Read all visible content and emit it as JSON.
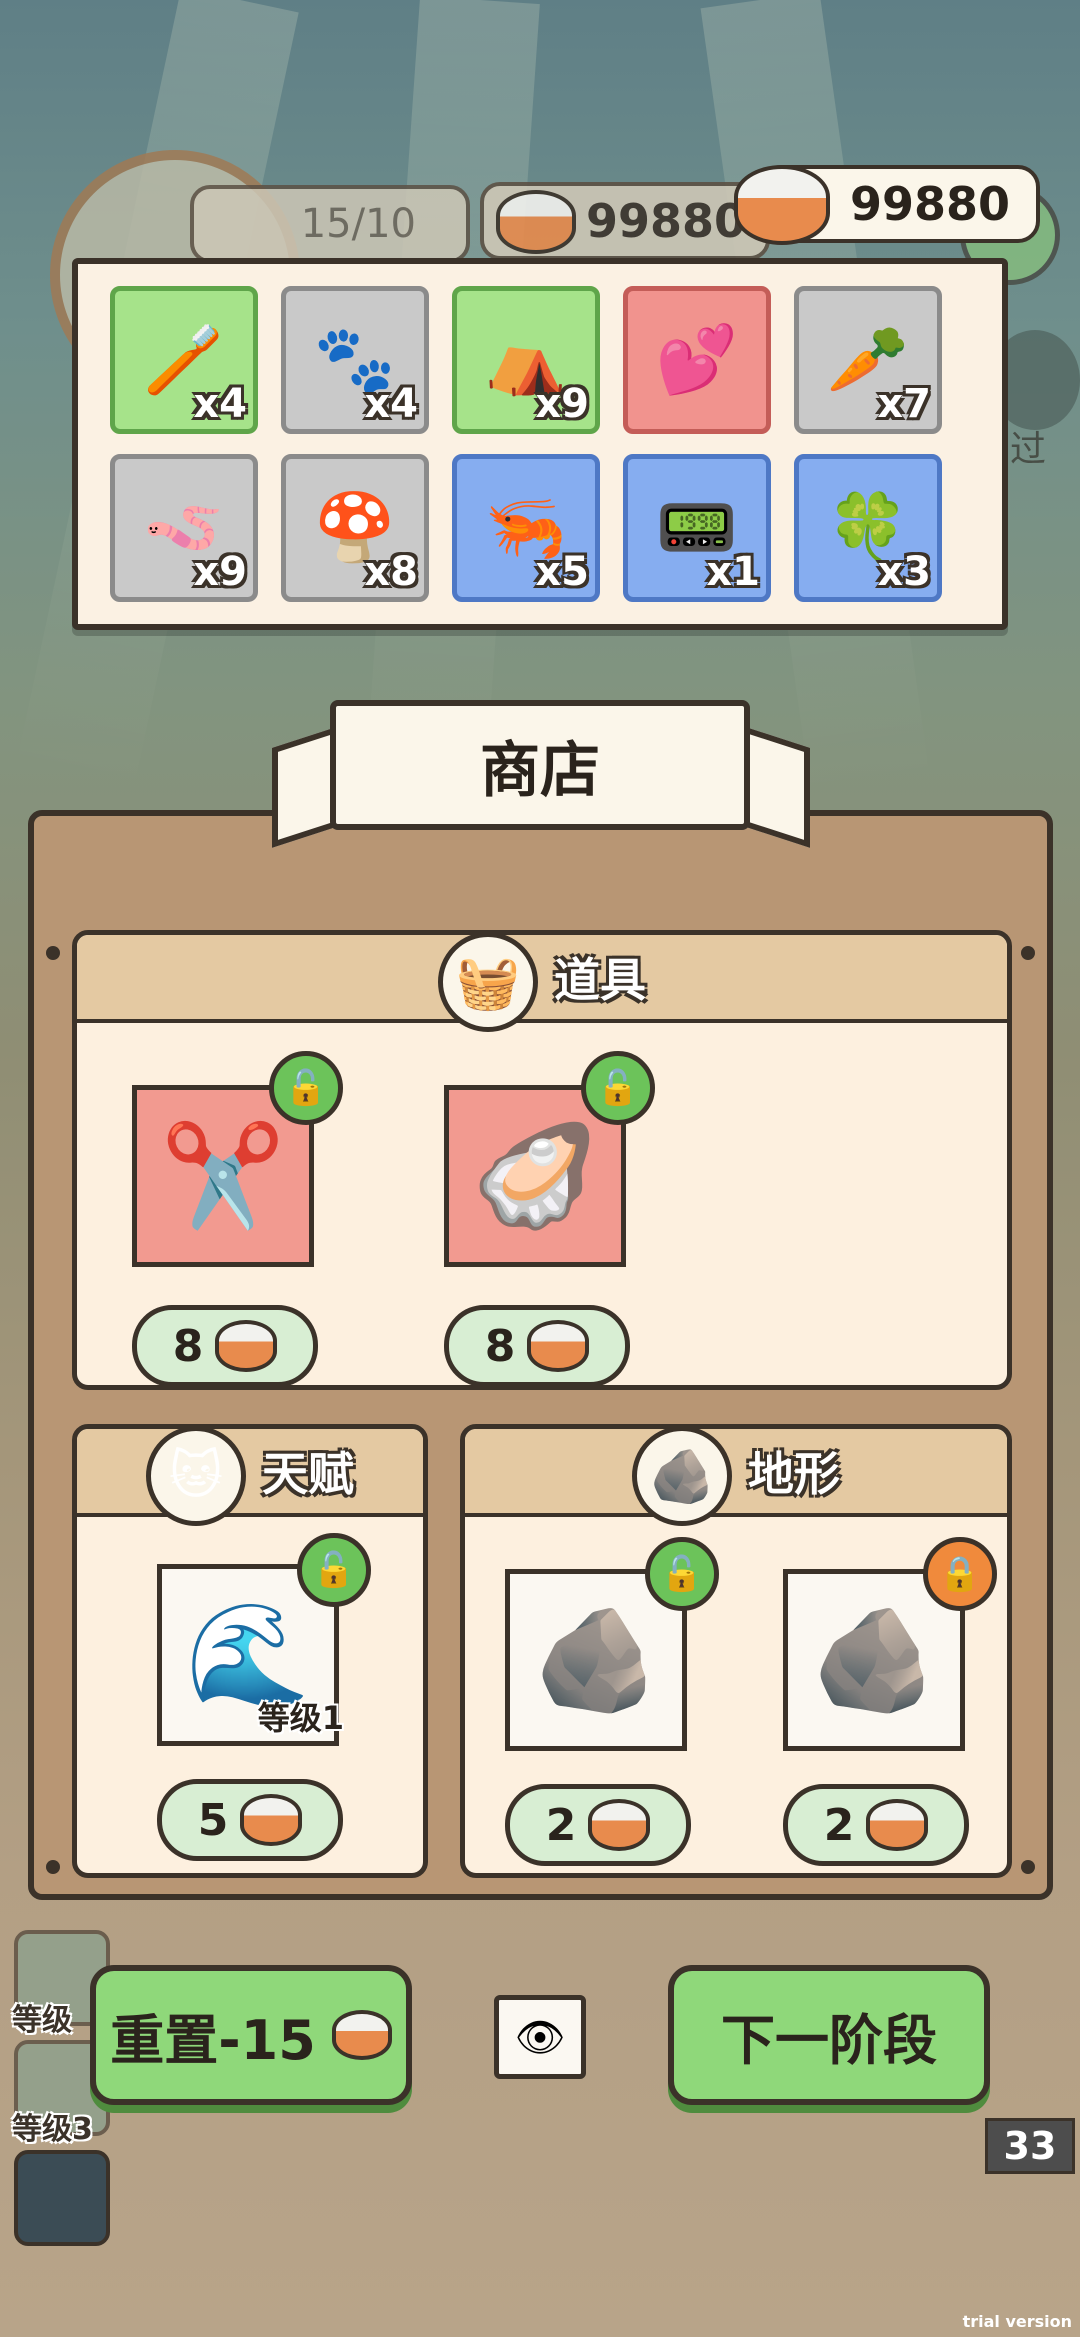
{
  "hud": {
    "level": "15/10",
    "coins_bg": "99880",
    "coins": "99880"
  },
  "inventory": [
    {
      "icon": "brush-icon",
      "glyph": "🪥",
      "count": "x4",
      "color": "green"
    },
    {
      "icon": "paw-card-icon",
      "glyph": "🐾",
      "count": "x4",
      "color": "grey"
    },
    {
      "icon": "tent-icon",
      "glyph": "⛺",
      "count": "x9",
      "color": "green"
    },
    {
      "icon": "hearts-toy-icon",
      "glyph": "💕",
      "count": "",
      "color": "red"
    },
    {
      "icon": "carrot-icon",
      "glyph": "🥕",
      "count": "x7",
      "color": "grey"
    },
    {
      "icon": "worm-icon",
      "glyph": "🪱",
      "count": "x9",
      "color": "grey"
    },
    {
      "icon": "mushroom-icon",
      "glyph": "🍄",
      "count": "x8",
      "color": "grey"
    },
    {
      "icon": "shrimp-icon",
      "glyph": "🦐",
      "count": "x5",
      "color": "blue"
    },
    {
      "icon": "robot-vacuum-icon",
      "glyph": "📟",
      "count": "x1",
      "color": "blue"
    },
    {
      "icon": "clover-charm-icon",
      "glyph": "🍀",
      "count": "x3",
      "color": "blue"
    }
  ],
  "shop": {
    "title": "商店",
    "items_section": {
      "title": "道具",
      "items": [
        {
          "icon": "scissors-egg-icon",
          "glyph": "✂️",
          "price": "8"
        },
        {
          "icon": "pearl-clam-icon",
          "glyph": "🦪",
          "price": "8"
        }
      ]
    },
    "talent_section": {
      "title": "天赋",
      "items": [
        {
          "icon": "wave-icon",
          "glyph": "🌊",
          "level": "等级1",
          "price": "5"
        }
      ]
    },
    "terrain_section": {
      "title": "地形",
      "items": [
        {
          "icon": "sand-rock-icon",
          "glyph": "🪨",
          "price": "2"
        },
        {
          "icon": "sand-rock-icon",
          "glyph": "🪨",
          "price": "2"
        }
      ]
    }
  },
  "bottom": {
    "reset_label": "重置-15",
    "next_label": "下一阶段",
    "side_level_1": "等级",
    "side_level_2": "等级3",
    "counter": "33",
    "side_text": "过"
  },
  "watermark": "trial version"
}
